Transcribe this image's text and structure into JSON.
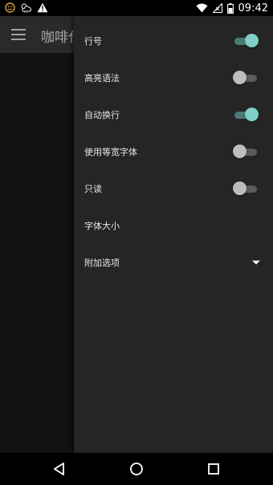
{
  "status_bar": {
    "time": "09:42",
    "left_icons": [
      "smiley-notification-icon",
      "weather-notification-icon",
      "warning-icon"
    ],
    "right_icons": [
      "wifi-icon",
      "no-signal-icon",
      "battery-icon"
    ]
  },
  "app_bar": {
    "title": "咖啡代"
  },
  "drawer": {
    "items": [
      {
        "label": "行号",
        "type": "switch",
        "on": true
      },
      {
        "label": "高亮语法",
        "type": "switch",
        "on": false
      },
      {
        "label": "自动换行",
        "type": "switch",
        "on": true
      },
      {
        "label": "使用等宽字体",
        "type": "switch",
        "on": false
      },
      {
        "label": "只读",
        "type": "switch",
        "on": false
      },
      {
        "label": "字体大小",
        "type": "item"
      },
      {
        "label": "附加选项",
        "type": "dropdown"
      }
    ]
  },
  "colors": {
    "accent_thumb": "#7fd0c6",
    "accent_track": "#4a7c77",
    "drawer_bg": "#252525"
  }
}
